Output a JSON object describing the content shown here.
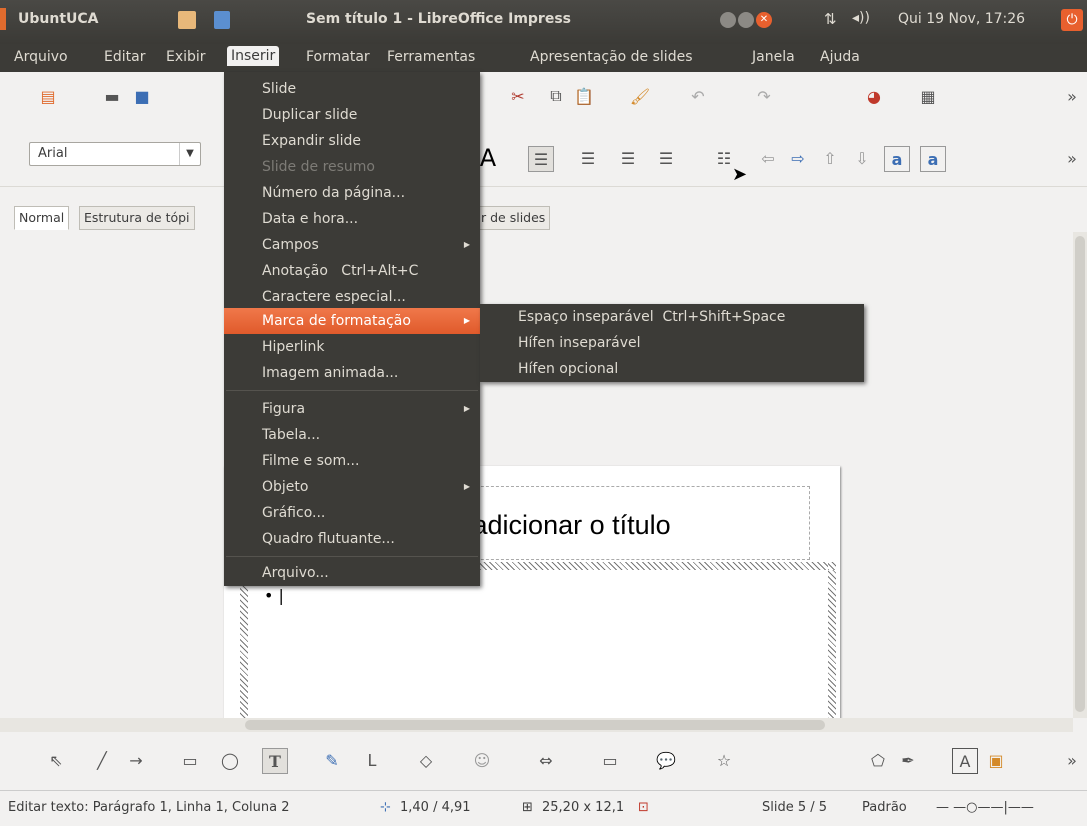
{
  "panel": {
    "app_name": "UbuntUCA",
    "window_title": "Sem título 1 - LibreOffice Impress",
    "clock": "Qui 19 Nov, 17:26"
  },
  "menubar": [
    "Arquivo",
    "Editar",
    "Exibir",
    "Inserir",
    "Formatar",
    "Ferramentas",
    "Apresentação de slides",
    "Janela",
    "Ajuda"
  ],
  "format_toolbar": {
    "font_name": "Arial"
  },
  "view_tabs": {
    "normal": "Normal",
    "outline": "Estrutura de tópi",
    "sorter": "r de slides"
  },
  "slide": {
    "title_placeholder": "a adicionar o título"
  },
  "insert_menu": {
    "items": [
      {
        "label": "Slide",
        "disabled": false
      },
      {
        "label": "Duplicar slide",
        "disabled": false
      },
      {
        "label": "Expandir slide",
        "disabled": false
      },
      {
        "label": "Slide de resumo",
        "disabled": true
      },
      {
        "label": "Número da página...",
        "disabled": false
      },
      {
        "label": "Data e hora...",
        "disabled": false
      },
      {
        "label": "Campos",
        "disabled": false
      },
      {
        "label": "Anotação",
        "shortcut": "Ctrl+Alt+C",
        "disabled": false
      },
      {
        "label": "Caractere especial...",
        "disabled": false
      },
      {
        "label": "Marca de formatação",
        "disabled": false
      },
      {
        "label": "Hiperlink",
        "disabled": false
      },
      {
        "label": "Imagem animada...",
        "disabled": false
      },
      {
        "label": "Figura",
        "disabled": false
      },
      {
        "label": "Tabela...",
        "disabled": false
      },
      {
        "label": "Filme e som...",
        "disabled": false
      },
      {
        "label": "Objeto",
        "disabled": false
      },
      {
        "label": "Gráfico...",
        "disabled": false
      },
      {
        "label": "Quadro flutuante...",
        "disabled": false
      },
      {
        "label": "Arquivo...",
        "disabled": false
      }
    ]
  },
  "submenu": {
    "items": [
      {
        "label": "Espaço inseparável",
        "shortcut": "Ctrl+Shift+Space"
      },
      {
        "label": "Hífen inseparável"
      },
      {
        "label": "Hífen opcional"
      }
    ]
  },
  "statusbar": {
    "edit_info": "Editar texto: Parágrafo 1, Linha 1, Coluna 2",
    "position": "1,40 / 4,91",
    "size": "25,20 x 12,1̀",
    "slide_info": "Slide 5 / 5",
    "layout": "Padrão"
  },
  "colors": {
    "highlight": "#e8602e",
    "menu_bg": "#3c3b37"
  }
}
